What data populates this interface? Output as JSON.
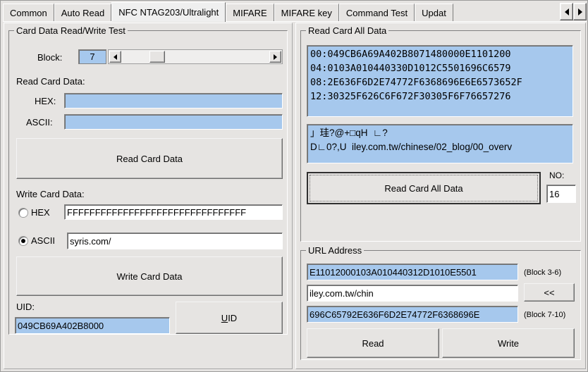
{
  "tabs": [
    {
      "label": "Common",
      "selected": false
    },
    {
      "label": "Auto Read",
      "selected": false
    },
    {
      "label": "NFC NTAG203/Ultralight",
      "selected": true
    },
    {
      "label": "MIFARE",
      "selected": false
    },
    {
      "label": "MIFARE key",
      "selected": false
    },
    {
      "label": "Command Test",
      "selected": false
    },
    {
      "label": "Updat",
      "selected": false
    }
  ],
  "tab_scroll": {
    "prev": "◄",
    "next": "►"
  },
  "left": {
    "group_title": "Card Data Read/Write Test",
    "block_label": "Block:",
    "block_value": "7",
    "read_section_label": "Read Card Data:",
    "hex_label": "HEX:",
    "hex_value": "",
    "ascii_label": "ASCII:",
    "ascii_value": "",
    "read_button": "Read Card Data",
    "write_section_label": "Write Card Data:",
    "write_hex_label": "HEX",
    "write_hex_value": "FFFFFFFFFFFFFFFFFFFFFFFFFFFFFFFF",
    "write_hex_selected": false,
    "write_ascii_label": "ASCII",
    "write_ascii_value": "syris.com/",
    "write_ascii_selected": true,
    "write_button": "Write Card Data",
    "uid_label": "UID:",
    "uid_value": "049CB69A402B8000",
    "uid_button_accel": "U",
    "uid_button_rest": "ID"
  },
  "right": {
    "all_data_group_title": "Read Card All Data",
    "hex_lines": [
      "00:049CB6A69A402B8071480000E1101200",
      "04:0103A010440330D1012C5501696C6579",
      "08:2E636F6D2E74772F6368696E6E6573652F",
      "12:30325F626C6F672F30305F6F76657276"
    ],
    "ascii_lines": [
      "」珪?@+□qH  ∟?",
      "D∟0?,U  iley.com.tw/chinese/02_blog/00_overv"
    ],
    "read_all_button": "Read Card All Data",
    "no_label": "NO:",
    "no_value": "16",
    "url_group_title": "URL Address",
    "url_hex_top": "E11012000103A010440312D1010E5501",
    "url_hex_top_note": "(Block 3-6)",
    "url_text": "iley.com.tw/chin",
    "url_back_button": "<<",
    "url_hex_bottom": "696C65792E636F6D2E74772F6368696E",
    "url_hex_bottom_note": "(Block 7-10)",
    "read_button": "Read",
    "write_button": "Write"
  },
  "colors": {
    "face": "#e6e4e2",
    "field_blue": "#a6c8ed",
    "field_white": "#ffffff"
  }
}
